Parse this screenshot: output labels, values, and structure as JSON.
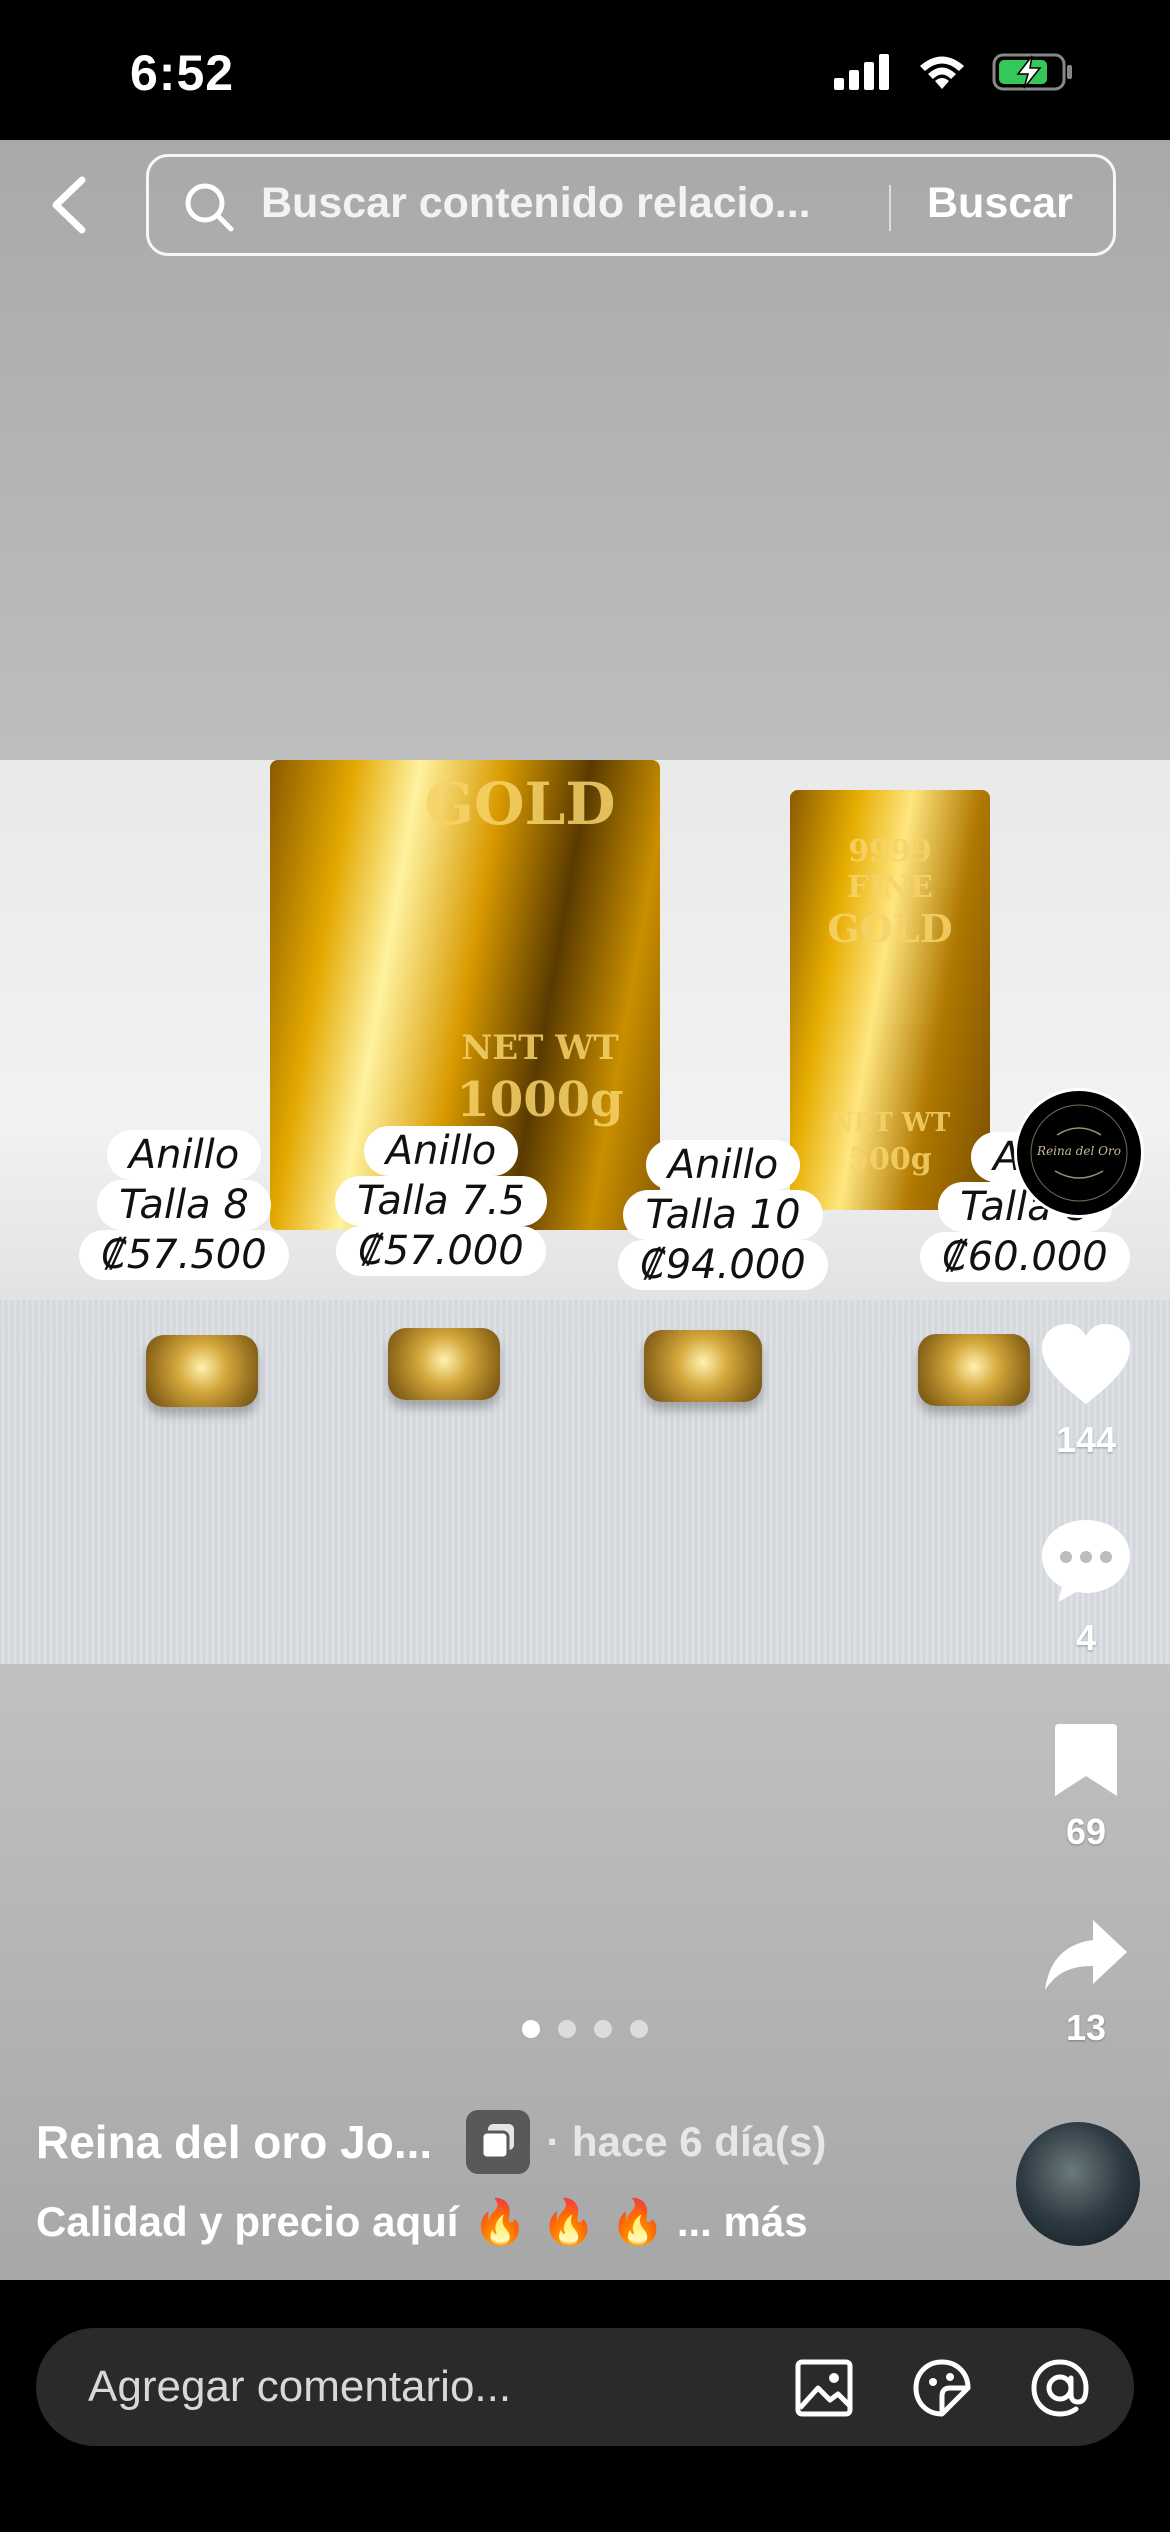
{
  "status_bar": {
    "time": "6:52"
  },
  "search": {
    "placeholder": "Buscar contenido relacio...",
    "button": "Buscar"
  },
  "post": {
    "price_tags": [
      {
        "line1": "Anillo",
        "line2": "Talla 8",
        "line3": "₡57.500"
      },
      {
        "line1": "Anillo",
        "line2": "Talla 7.5",
        "line3": "₡57.000"
      },
      {
        "line1": "Anillo",
        "line2": "Talla 10",
        "line3": "₡94.000"
      },
      {
        "line1": "Ani",
        "line2": "Talla 8",
        "line3": "₡60.000"
      }
    ],
    "bar_engraving": {
      "big_top": "GOLD",
      "big_bottom1": "NET WT",
      "big_bottom2": "1000g",
      "small_top": "9999",
      "small_mid1": "FINE",
      "small_mid2": "GOLD",
      "small_bottom1": "NET WT",
      "small_bottom2": "500g"
    },
    "page_indicator": {
      "total": 4,
      "active": 1
    },
    "author": "Reina del oro Jo...",
    "posted": "· hace 6 día(s)",
    "caption": "Calidad y precio aquí",
    "caption_emoji": "🔥",
    "more": "... más"
  },
  "actions": {
    "likes": "144",
    "comments": "4",
    "saves": "69",
    "shares": "13"
  },
  "comment_bar": {
    "placeholder": "Agregar comentario..."
  },
  "colors": {
    "accent_white": "#ffffff",
    "bottom_bg": "#000000",
    "input_bg": "#2a2a2a"
  }
}
